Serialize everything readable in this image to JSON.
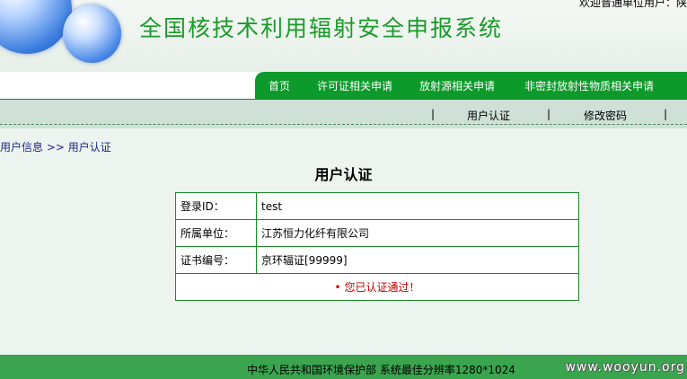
{
  "header": {
    "title": "全国核技术利用辐射安全申报系统",
    "welcome": "欢迎普通单位用户：陕"
  },
  "nav": {
    "items": [
      {
        "label": "首页"
      },
      {
        "label": "许可证相关申请"
      },
      {
        "label": "放射源相关申请"
      },
      {
        "label": "非密封放射性物质相关申请"
      }
    ]
  },
  "subnav": {
    "items": [
      {
        "label": "用户认证"
      },
      {
        "label": "修改密码"
      }
    ]
  },
  "breadcrumb": "用户信息 >> 用户认证",
  "page_title": "用户认证",
  "info": {
    "rows": [
      {
        "label": "登录ID：",
        "value": "test"
      },
      {
        "label": "所属单位：",
        "value": "江苏恒力化纤有限公司"
      },
      {
        "label": "证书编号：",
        "value": "京环辐证[99999]"
      }
    ],
    "status": "• 您已认证通过！"
  },
  "footer": {
    "text": "中华人民共和国环境保护部 系统最佳分辨率1280*1024",
    "watermark": "www.wooyun.org"
  }
}
